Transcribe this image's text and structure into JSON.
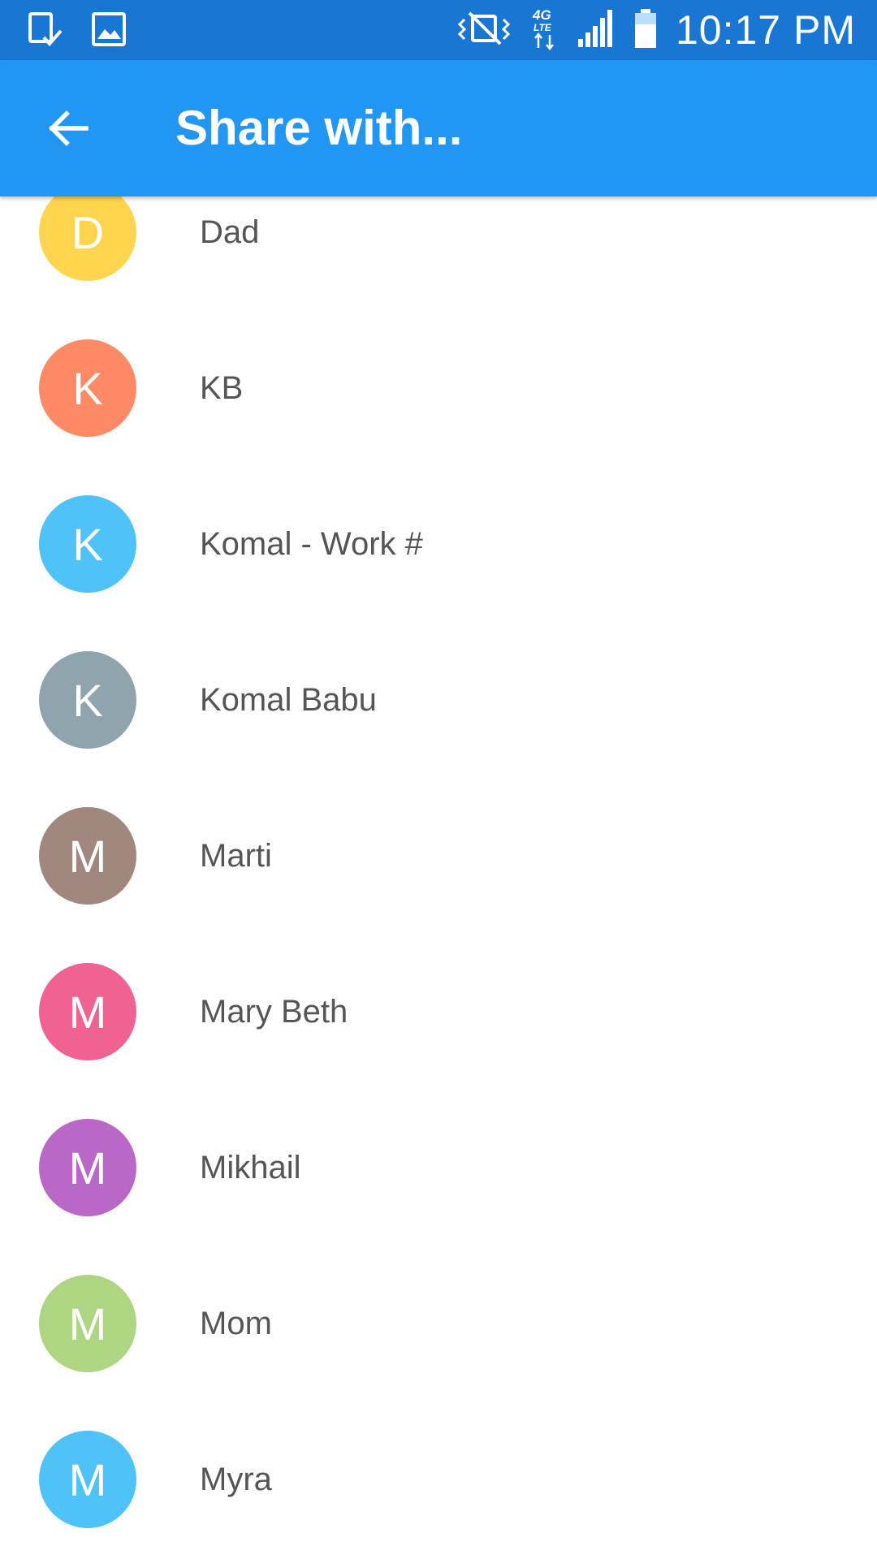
{
  "status_bar": {
    "time": "10:17 PM",
    "network": "4G LTE",
    "icons": [
      "download-done-icon",
      "image-icon",
      "vibrate-mute-icon",
      "4g-lte-icon",
      "signal-icon",
      "battery-icon"
    ]
  },
  "app_bar": {
    "title": "Share with...",
    "back_icon": "arrow-back-icon",
    "color": "#2196f3"
  },
  "contacts": [
    {
      "initial": "D",
      "name": "Dad",
      "color": "#ffd54f"
    },
    {
      "initial": "K",
      "name": "KB",
      "color": "#ff8a65"
    },
    {
      "initial": "K",
      "name": "Komal - Work #",
      "color": "#4fc3f7"
    },
    {
      "initial": "K",
      "name": "Komal Babu",
      "color": "#90a4ae"
    },
    {
      "initial": "M",
      "name": "Marti",
      "color": "#a1887f"
    },
    {
      "initial": "M",
      "name": "Mary Beth",
      "color": "#f06292"
    },
    {
      "initial": "M",
      "name": "Mikhail",
      "color": "#ba68c8"
    },
    {
      "initial": "M",
      "name": "Mom",
      "color": "#aed581"
    },
    {
      "initial": "M",
      "name": "Myra",
      "color": "#4fc3f7"
    }
  ]
}
